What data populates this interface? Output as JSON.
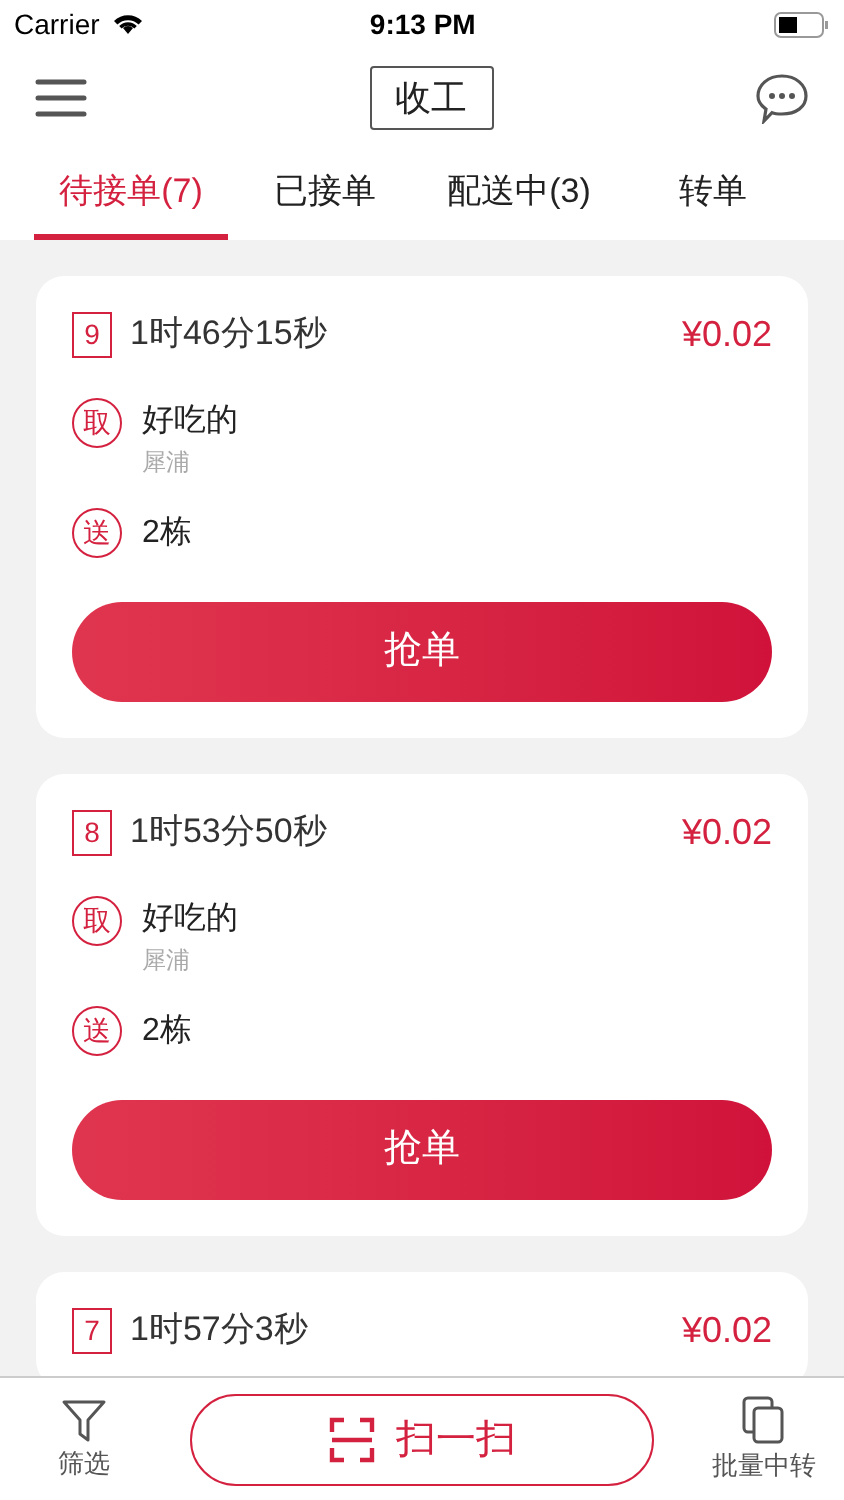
{
  "status_bar": {
    "carrier": "Carrier",
    "time": "9:13 PM"
  },
  "header": {
    "title": "收工"
  },
  "tabs": [
    {
      "label": "待接单(7)",
      "selected": true
    },
    {
      "label": "已接单",
      "selected": false
    },
    {
      "label": "配送中(3)",
      "selected": false
    },
    {
      "label": "转单",
      "selected": false
    }
  ],
  "orders": [
    {
      "number": "9",
      "elapsed": "1时46分15秒",
      "price": "¥0.02",
      "pickup": {
        "badge": "取",
        "name": "好吃的",
        "area": "犀浦"
      },
      "delivery": {
        "badge": "送",
        "name": "2栋"
      },
      "action": "抢单"
    },
    {
      "number": "8",
      "elapsed": "1时53分50秒",
      "price": "¥0.02",
      "pickup": {
        "badge": "取",
        "name": "好吃的",
        "area": "犀浦"
      },
      "delivery": {
        "badge": "送",
        "name": "2栋"
      },
      "action": "抢单"
    },
    {
      "number": "7",
      "elapsed": "1时57分3秒",
      "price": "¥0.02"
    }
  ],
  "bottom_bar": {
    "filter": "筛选",
    "scan": "扫一扫",
    "batch": "批量中转"
  }
}
